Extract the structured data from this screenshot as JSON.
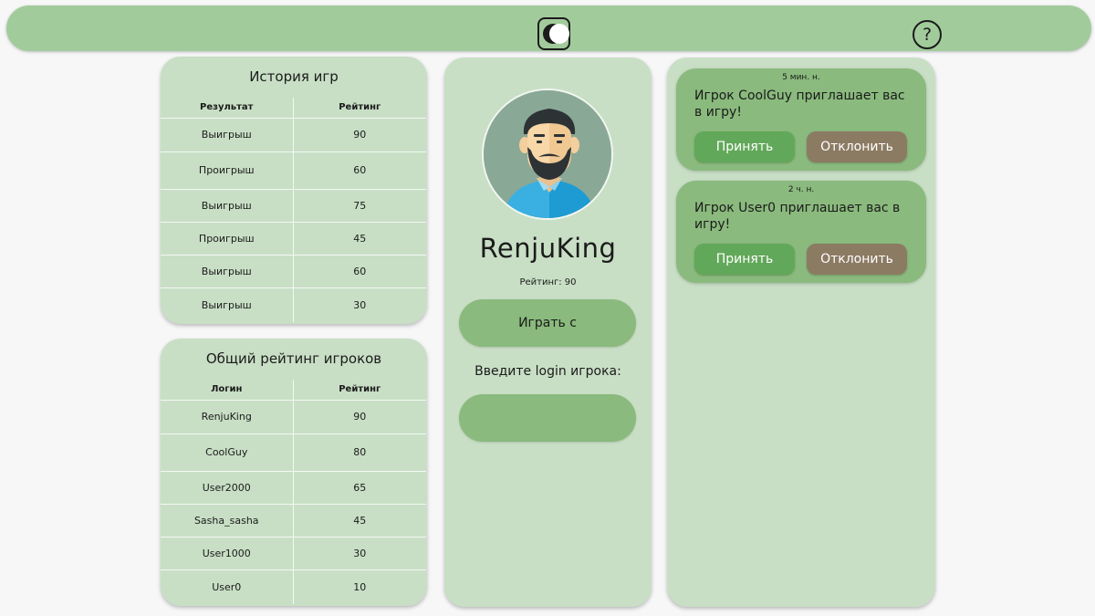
{
  "header": {
    "theme_toggle_icon": "theme-toggle-icon",
    "help_label": "?"
  },
  "history": {
    "title": "История игр",
    "columns": [
      "Результат",
      "Рейтинг"
    ],
    "rows": [
      {
        "result": "Выигрыш",
        "rating": "90"
      },
      {
        "result": "Проигрыш",
        "rating": "60"
      },
      {
        "result": "Выигрыш",
        "rating": "75"
      },
      {
        "result": "Проигрыш",
        "rating": "45"
      },
      {
        "result": "Выигрыш",
        "rating": "60"
      },
      {
        "result": "Выигрыш",
        "rating": "30"
      }
    ]
  },
  "leaderboard": {
    "title": "Общий рейтинг игроков",
    "columns": [
      "Логин",
      "Рейтинг"
    ],
    "rows": [
      {
        "login": "RenjuKing",
        "rating": "90"
      },
      {
        "login": "CoolGuy",
        "rating": "80"
      },
      {
        "login": "User2000",
        "rating": "65"
      },
      {
        "login": "Sasha_sasha",
        "rating": "45"
      },
      {
        "login": "User1000",
        "rating": "30"
      },
      {
        "login": "User0",
        "rating": "10"
      }
    ]
  },
  "profile": {
    "avatar_icon": "user-avatar-icon",
    "nickname": "RenjuKing",
    "rating_text": "Рейтинг: 90",
    "play_button": "Играть с",
    "login_label": "Введите login игрока:",
    "login_value": "",
    "login_placeholder": ""
  },
  "invitations": [
    {
      "time": "5 мин. н.",
      "text": "Игрок CoolGuy приглашает вас в игру!",
      "accept": "Принять",
      "decline": "Отклонить"
    },
    {
      "time": "2 ч. н.",
      "text": "Игрок User0 приглашает вас в игру!",
      "accept": "Принять",
      "decline": "Отклонить"
    }
  ],
  "colors": {
    "background": "#f7f7f8",
    "bar": "#a2cb9c",
    "panel": "#c8dfc5",
    "accent": "#8aba7d",
    "accept": "#62a85a",
    "decline": "#8c7b63"
  }
}
